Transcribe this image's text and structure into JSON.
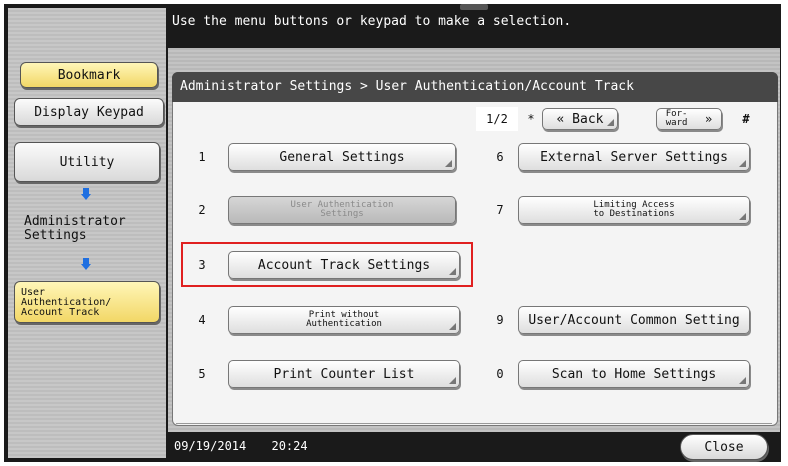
{
  "header": {
    "instruction": "Use the menu buttons or keypad to make a selection."
  },
  "sidebar": {
    "bookmark": "Bookmark",
    "display_keypad": "Display Keypad",
    "utility": "Utility",
    "administrator_settings": "Administrator\nSettings",
    "current": "User\nAuthentication/\nAccount Track"
  },
  "breadcrumb": "Administrator Settings > User Authentication/Account Track",
  "pager": {
    "page": "1/2",
    "star": "*",
    "back": "« Back",
    "forward": "For-\nward",
    "forward_arrow": "»",
    "hash": "#"
  },
  "menu": {
    "n1": "1",
    "b1": "General Settings",
    "n2": "2",
    "b2": "User Authentication\nSettings",
    "n3": "3",
    "b3": "Account Track Settings",
    "n4": "4",
    "b4": "Print without\nAuthentication",
    "n5": "5",
    "b5": "Print Counter List",
    "n6": "6",
    "b6": "External Server Settings",
    "n7": "7",
    "b7": "Limiting Access\nto Destinations",
    "n9": "9",
    "b9": "User/Account Common Setting",
    "n0": "0",
    "b0": "Scan to Home Settings"
  },
  "status": {
    "date": "09/19/2014",
    "time": "20:24",
    "close": "Close"
  }
}
